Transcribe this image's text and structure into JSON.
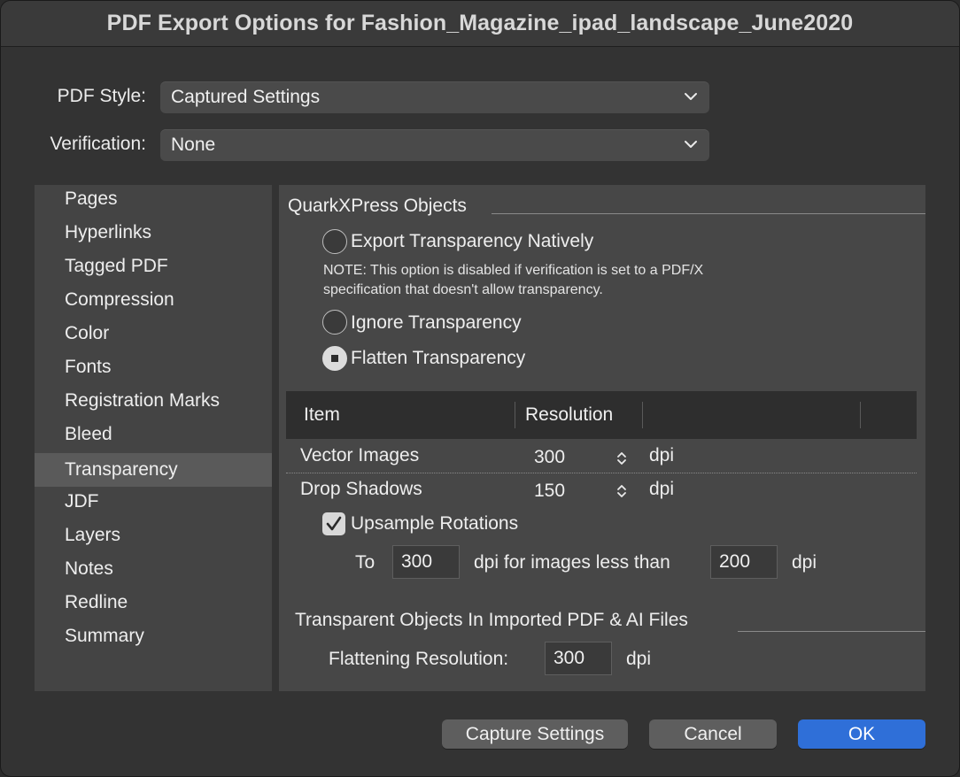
{
  "window": {
    "title": "PDF Export Options for Fashion_Magazine_ipad_landscape_June2020"
  },
  "pdf_style": {
    "label": "PDF Style:",
    "value": "Captured Settings"
  },
  "verification": {
    "label": "Verification:",
    "value": "None"
  },
  "sidebar": {
    "items": [
      {
        "label": "Pages"
      },
      {
        "label": "Hyperlinks"
      },
      {
        "label": "Tagged PDF"
      },
      {
        "label": "Compression"
      },
      {
        "label": "Color"
      },
      {
        "label": "Fonts"
      },
      {
        "label": "Registration Marks"
      },
      {
        "label": "Bleed"
      },
      {
        "label": "Transparency",
        "selected": true
      },
      {
        "label": "JDF"
      },
      {
        "label": "Layers"
      },
      {
        "label": "Notes"
      },
      {
        "label": "Redline"
      },
      {
        "label": "Summary"
      }
    ]
  },
  "transparency": {
    "section_title": "QuarkXPress Objects",
    "options": [
      {
        "label": "Export Transparency Natively",
        "selected": false
      },
      {
        "label": "Ignore Transparency",
        "selected": false
      },
      {
        "label": "Flatten Transparency",
        "selected": true
      }
    ],
    "note_line1": "NOTE: This option is disabled if verification is set to a PDF/X",
    "note_line2": "specification that doesn't allow transparency.",
    "table": {
      "headers": [
        "Item",
        "Resolution"
      ],
      "rows": [
        {
          "item": "Vector Images",
          "resolution": "300",
          "unit": "dpi"
        },
        {
          "item": "Drop Shadows",
          "resolution": "150",
          "unit": "dpi"
        }
      ]
    },
    "upsample": {
      "label": "Upsample Rotations",
      "checked": true,
      "to_label": "To",
      "to_value": "300",
      "middle_label": "dpi for images less than",
      "less_than_value": "200",
      "unit": "dpi"
    },
    "imported": {
      "section_title": "Transparent Objects In Imported PDF & AI Files",
      "label": "Flattening Resolution:",
      "value": "300",
      "unit": "dpi"
    }
  },
  "buttons": {
    "capture": "Capture Settings",
    "cancel": "Cancel",
    "ok": "OK"
  },
  "colors": {
    "accent": "#2f6fd8",
    "dialog_bg": "#333333",
    "panel_bg": "#474747",
    "sidebar_selected": "#5a5a5a"
  }
}
